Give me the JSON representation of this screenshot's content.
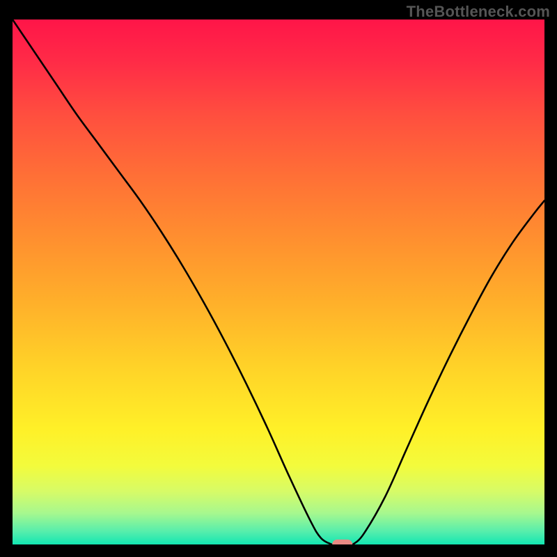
{
  "watermark": "TheBottleneck.com",
  "chart_data": {
    "type": "line",
    "title": "",
    "xlabel": "",
    "ylabel": "",
    "xlim": [
      0,
      100
    ],
    "ylim": [
      0,
      100
    ],
    "series": [
      {
        "name": "curve-left",
        "x": [
          0,
          4,
          8,
          12,
          16,
          20,
          24,
          28,
          32,
          36,
          40,
          44,
          48,
          52,
          56,
          58,
          60
        ],
        "values": [
          100,
          94,
          88,
          82,
          76.5,
          71,
          65.5,
          59.5,
          53,
          46,
          38.5,
          30.5,
          22,
          13,
          4.5,
          1.2,
          0
        ]
      },
      {
        "name": "curve-right",
        "x": [
          64,
          66,
          70,
          74,
          78,
          82,
          86,
          90,
          94,
          98,
          100
        ],
        "values": [
          0,
          2,
          9,
          18,
          27,
          35.5,
          43.5,
          51,
          57.5,
          63,
          65.5
        ]
      },
      {
        "name": "curve-flat",
        "x": [
          60,
          62,
          64
        ],
        "values": [
          0,
          0,
          0
        ]
      }
    ],
    "marker": {
      "name": "optimal-marker",
      "x": 62,
      "y": 0,
      "color": "#e88a84",
      "width": 3.8,
      "height": 1.9
    },
    "gradient_stops": [
      {
        "offset": 0.0,
        "color": "#ff1548"
      },
      {
        "offset": 0.08,
        "color": "#ff2b47"
      },
      {
        "offset": 0.18,
        "color": "#ff4e3f"
      },
      {
        "offset": 0.3,
        "color": "#ff7036"
      },
      {
        "offset": 0.42,
        "color": "#ff902f"
      },
      {
        "offset": 0.54,
        "color": "#ffb02a"
      },
      {
        "offset": 0.66,
        "color": "#ffd228"
      },
      {
        "offset": 0.78,
        "color": "#fff028"
      },
      {
        "offset": 0.85,
        "color": "#f3fb3c"
      },
      {
        "offset": 0.9,
        "color": "#d6fb68"
      },
      {
        "offset": 0.94,
        "color": "#a7f88e"
      },
      {
        "offset": 0.975,
        "color": "#57eeac"
      },
      {
        "offset": 1.0,
        "color": "#12e6b2"
      }
    ]
  }
}
